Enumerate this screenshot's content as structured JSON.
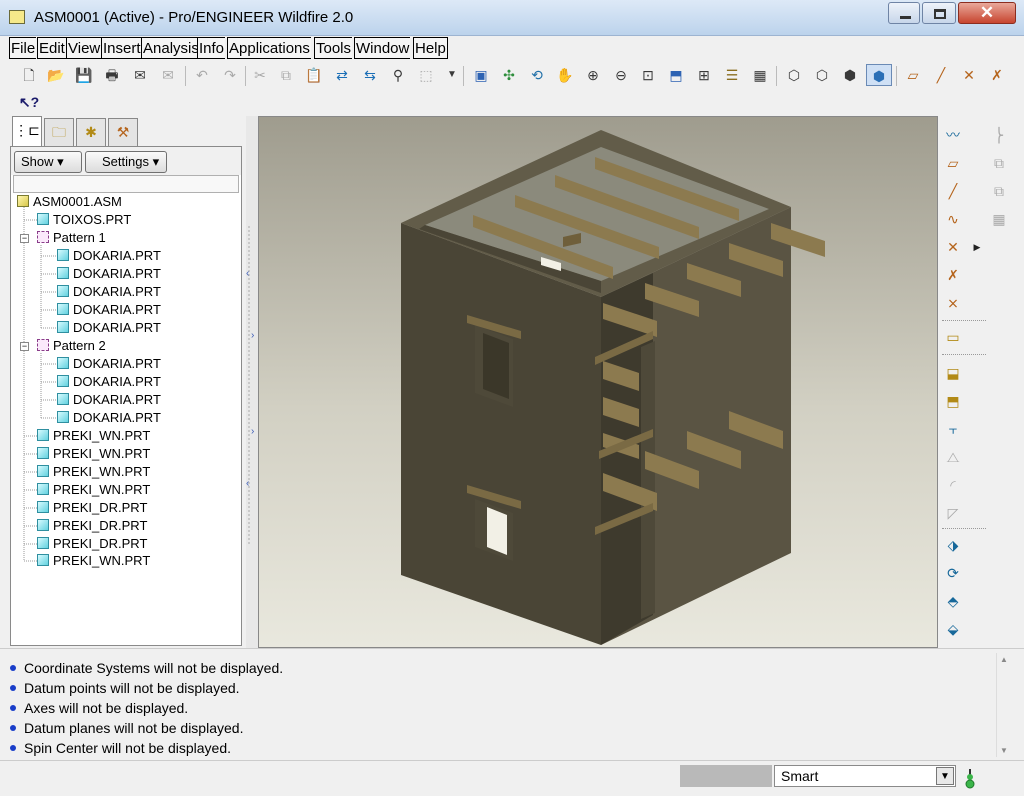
{
  "window": {
    "title": "ASM0001 (Active) - Pro/ENGINEER Wildfire 2.0",
    "close_glyph": "✕"
  },
  "menu": [
    "File",
    "Edit",
    "View",
    "Insert",
    "Analysis",
    "Info",
    "Applications",
    "Tools",
    "Window",
    "Help"
  ],
  "toolbar_icons": [
    "new-icon",
    "open-icon",
    "save-icon",
    "print-icon",
    "email-icon",
    "email-link-icon",
    "undo-icon",
    "redo-icon",
    "cut-icon",
    "copy-icon",
    "paste-icon",
    "paste-special-icon",
    "regenerate-icon",
    "regen-manager-icon",
    "find-icon",
    "select-box-icon",
    "select-dropdown-icon",
    "repaint-icon",
    "spin-center-icon",
    "orient-mode-icon",
    "pan-icon",
    "zoom-in-icon",
    "zoom-out-icon",
    "refit-icon",
    "reorient-icon",
    "saved-views-icon",
    "layers-icon",
    "view-manager-icon",
    "wireframe-icon",
    "hidden-line-icon",
    "no-hidden-icon",
    "shading-icon",
    "datum-planes-icon",
    "datum-axes-icon",
    "datum-points-icon",
    "coordinate-systems-icon"
  ],
  "panel": {
    "tabs": [
      "model-tree-tab",
      "folder-browser-tab",
      "favorites-tab",
      "connections-tab"
    ],
    "show_label": "Show",
    "settings_label": "Settings"
  },
  "tree": {
    "root": "ASM0001.ASM",
    "items": [
      {
        "label": "TOIXOS.PRT",
        "type": "part"
      },
      {
        "label": "Pattern 1",
        "type": "pattern"
      },
      {
        "label": "DOKARIA.PRT",
        "type": "part"
      },
      {
        "label": "DOKARIA.PRT",
        "type": "part"
      },
      {
        "label": "DOKARIA.PRT",
        "type": "part"
      },
      {
        "label": "DOKARIA.PRT",
        "type": "part"
      },
      {
        "label": "DOKARIA.PRT",
        "type": "part"
      },
      {
        "label": "Pattern 2",
        "type": "pattern"
      },
      {
        "label": "DOKARIA.PRT",
        "type": "part"
      },
      {
        "label": "DOKARIA.PRT",
        "type": "part"
      },
      {
        "label": "DOKARIA.PRT",
        "type": "part"
      },
      {
        "label": "DOKARIA.PRT",
        "type": "part"
      },
      {
        "label": "PREKI_WN.PRT",
        "type": "part"
      },
      {
        "label": "PREKI_WN.PRT",
        "type": "part"
      },
      {
        "label": "PREKI_WN.PRT",
        "type": "part"
      },
      {
        "label": "PREKI_WN.PRT",
        "type": "part"
      },
      {
        "label": "PREKI_DR.PRT",
        "type": "part"
      },
      {
        "label": "PREKI_DR.PRT",
        "type": "part"
      },
      {
        "label": "PREKI_DR.PRT",
        "type": "part"
      },
      {
        "label": "PREKI_WN.PRT",
        "type": "part"
      }
    ]
  },
  "right_toolbar_icons": [
    "sketch-tool-icon",
    "datum-plane-icon",
    "datum-axis-icon",
    "datum-curve-icon",
    "datum-point-icon",
    "datum-csys-icon",
    "analysis-feature-icon",
    "hole-icon",
    "shell-icon",
    "rib-icon",
    "draft-icon",
    "round-icon",
    "chamfer-icon",
    "extrude-icon",
    "revolve-icon",
    "sweep-icon",
    "blend-icon"
  ],
  "messages": [
    "Coordinate Systems will not be displayed.",
    "Datum points will not be displayed.",
    "Axes will not be displayed.",
    "Datum planes will not be displayed.",
    "Spin Center will not be displayed."
  ],
  "status": {
    "filter": "Smart"
  },
  "colors": {
    "wall": "#4a4536",
    "wall_side": "#5a5443",
    "wall_top": "#625c49",
    "beam": "#8c7a4f",
    "beam_dark": "#6f5f3b"
  }
}
